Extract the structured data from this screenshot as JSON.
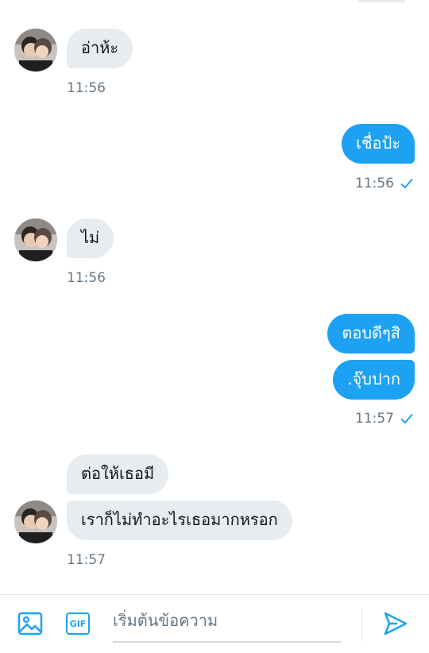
{
  "conversation": {
    "incoming_1": {
      "text": "อ่าห้ะ",
      "time": "11:56"
    },
    "outgoing_1": {
      "text": "เชื่อป้ะ",
      "time": "11:56"
    },
    "incoming_2": {
      "text": "ไม่",
      "time": "11:56"
    },
    "outgoing_2": {
      "texts": [
        "ตอบดีๆสิ",
        ".จุ๊บปาก"
      ],
      "time": "11:57"
    },
    "incoming_3": {
      "texts": [
        "ต่อให้เธอมี",
        "เราก็ไม่ทำอะไรเธอมากหรอก"
      ],
      "time": "11:57"
    }
  },
  "composer": {
    "placeholder": "เริ่มต้นข้อความ",
    "gif_label": "GIF"
  },
  "colors": {
    "accent": "#1da1f2",
    "incoming_bubble": "#e6ecf0",
    "muted_text": "#657786"
  },
  "icons": {
    "image": "image-icon",
    "gif": "gif-icon",
    "send": "send-icon",
    "read_receipt": "checkmark-icon"
  }
}
